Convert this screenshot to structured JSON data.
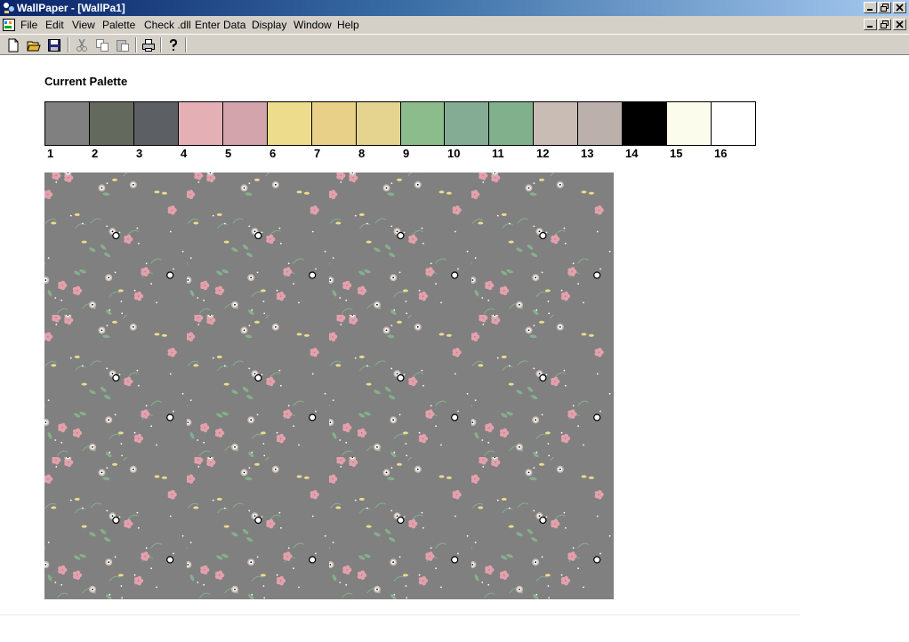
{
  "window": {
    "title": "WallPaper - [WallPa1]"
  },
  "menu": [
    {
      "label": "File"
    },
    {
      "label": "Edit"
    },
    {
      "label": "View"
    },
    {
      "label": "Palette"
    },
    {
      "label": "Check .dll"
    },
    {
      "label": "Enter Data"
    },
    {
      "label": "Display"
    },
    {
      "label": "Window"
    },
    {
      "label": "Help"
    }
  ],
  "toolbar": {
    "buttons": [
      "new-icon",
      "open-icon",
      "save-icon",
      "cut-icon",
      "copy-icon",
      "paste-icon",
      "print-icon",
      "help-icon"
    ]
  },
  "palette": {
    "title": "Current Palette",
    "swatches": [
      {
        "label": "1",
        "color": "#808080"
      },
      {
        "label": "2",
        "color": "#64695e"
      },
      {
        "label": "3",
        "color": "#5c5f64"
      },
      {
        "label": "4",
        "color": "#e4b0b6"
      },
      {
        "label": "5",
        "color": "#d4a4ad"
      },
      {
        "label": "6",
        "color": "#ecdc8c"
      },
      {
        "label": "7",
        "color": "#e8d088"
      },
      {
        "label": "8",
        "color": "#e4d490"
      },
      {
        "label": "9",
        "color": "#8cbc8c"
      },
      {
        "label": "10",
        "color": "#84ac94"
      },
      {
        "label": "11",
        "color": "#80b08c"
      },
      {
        "label": "12",
        "color": "#c8bcb4"
      },
      {
        "label": "13",
        "color": "#bcb0ac"
      },
      {
        "label": "14",
        "color": "#000000"
      },
      {
        "label": "15",
        "color": "#fcfcec"
      },
      {
        "label": "16",
        "color": "#ffffff"
      }
    ]
  },
  "wallpaper": {
    "background": "#808080",
    "motif_colors": [
      "#e4a0ac",
      "#84b08c",
      "#ecdc8c",
      "#c8bcb4",
      "#ffffff",
      "#000000"
    ]
  }
}
